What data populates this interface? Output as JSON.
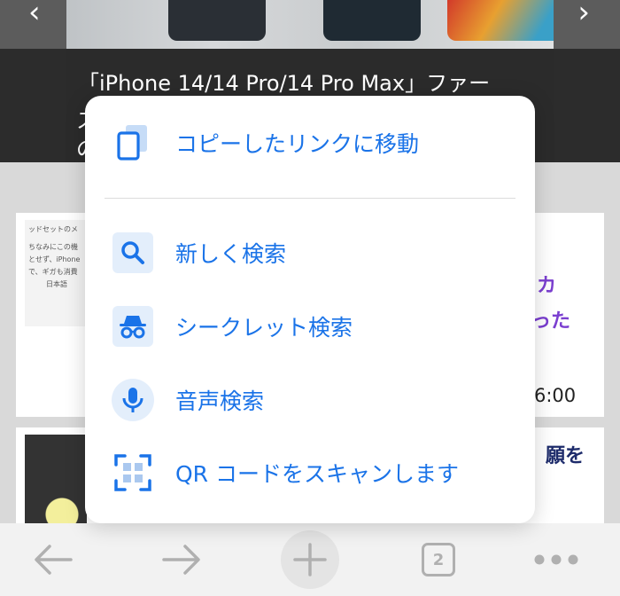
{
  "background": {
    "article_title": "「iPhone 14/14 Pro/14 Pro Max」ファー",
    "article_title_cont_1": "ス",
    "article_title_cont_2": "の",
    "thumb_text": [
      "ッドセットのメ",
      "ちなみにこの機",
      "とせず、iPhone",
      "で、ギガも消費",
      "日本語"
    ],
    "card1_headline_frag_1": "カ",
    "card1_headline_frag_2": "った",
    "card1_time": "6:00",
    "card2_headline_frag": "願を"
  },
  "menu": {
    "items": [
      {
        "label": "コピーしたリンクに移動",
        "icon": "clipboard-icon"
      },
      {
        "label": "新しく検索",
        "icon": "search-icon"
      },
      {
        "label": "シークレット検索",
        "icon": "incognito-icon"
      },
      {
        "label": "音声検索",
        "icon": "microphone-icon"
      },
      {
        "label": "QR コードをスキャンします",
        "icon": "qr-scan-icon"
      }
    ]
  },
  "toolbar": {
    "tab_count": "2"
  },
  "colors": {
    "accent": "#1a73e8",
    "icon_bg": "#e3eefb",
    "toolbar_icon": "#b0b0b0"
  }
}
